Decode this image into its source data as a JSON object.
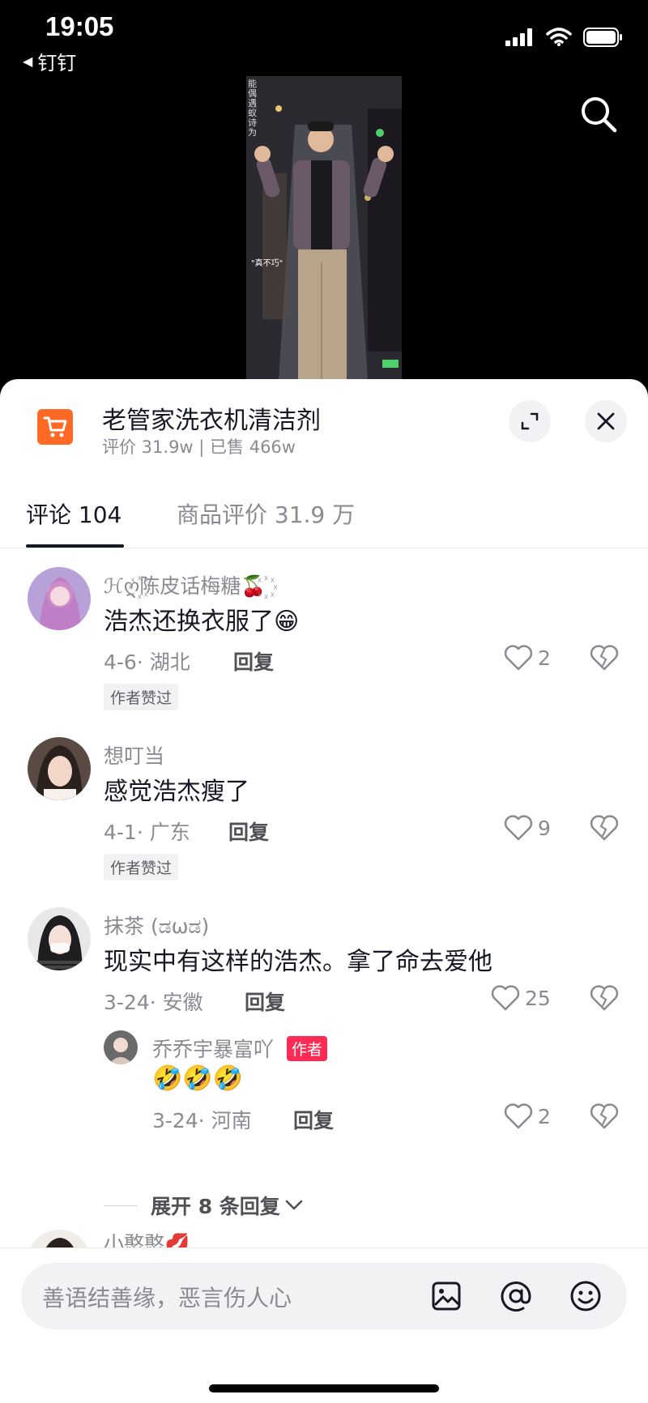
{
  "status_bar": {
    "time": "19:05",
    "back_app": "钉钉"
  },
  "video": {
    "caption": "\"真不巧\"",
    "side_text": "能偶遇蚁诗为"
  },
  "product": {
    "title": "老管家洗衣机清洁剂",
    "meta": "评价 31.9w | 已售 466w",
    "icon": "shopping-cart-icon"
  },
  "tabs": {
    "comments": "评论 104",
    "reviews": "商品评价 31.9 万"
  },
  "comments": [
    {
      "user": "ℋღ꙰陈皮话梅糖🍒꙰",
      "text": "浩杰还换衣服了😁",
      "meta": "4-6· 湖北",
      "reply": "回复",
      "likes": "2",
      "author_liked": "作者赞过"
    },
    {
      "user": "想叮当",
      "text": "感觉浩杰瘦了",
      "meta": "4-1· 广东",
      "reply": "回复",
      "likes": "9",
      "author_liked": "作者赞过"
    },
    {
      "user": "抹茶 (ಡωಡ)",
      "text": "现实中有这样的浩杰。拿了命去爱他",
      "meta": "3-24· 安徽",
      "reply": "回复",
      "likes": "25",
      "sub_reply": {
        "user": "乔乔宇暴富吖",
        "badge": "作者",
        "text": "🤣🤣🤣",
        "meta": "3-24· 河南",
        "reply": "回复",
        "likes": "2"
      },
      "expand": "展开 8 条回复"
    },
    {
      "user": "小憨憨💋"
    }
  ],
  "input": {
    "placeholder": "善语结善缘，恶言伤人心"
  }
}
